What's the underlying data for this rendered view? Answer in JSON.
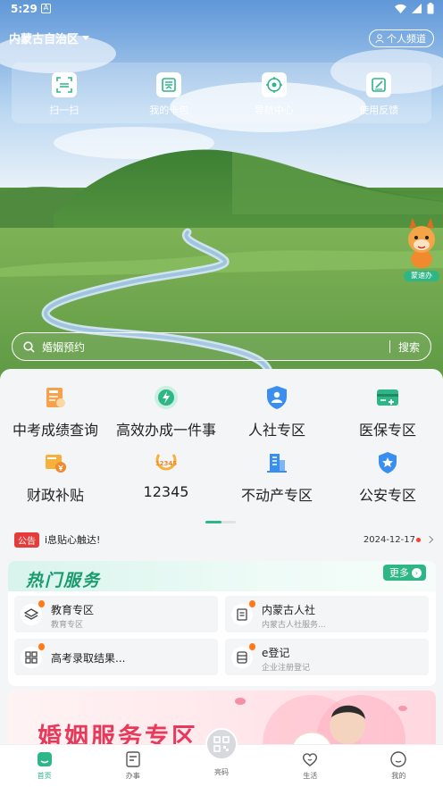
{
  "status_bar": {
    "time": "5:29",
    "indicator": "A"
  },
  "header": {
    "region": "内蒙古自治区",
    "personal": "个人频道"
  },
  "quick_actions": [
    {
      "label": "扫一扫",
      "icon": "scan-icon"
    },
    {
      "label": "我的卡包",
      "icon": "card-wallet-icon"
    },
    {
      "label": "导航中心",
      "icon": "navigation-icon"
    },
    {
      "label": "使用反馈",
      "icon": "feedback-icon"
    }
  ],
  "search": {
    "placeholder": "婚姻预约",
    "button": "搜索"
  },
  "services": [
    {
      "label": "中考成绩查询",
      "icon": "exam-score-icon",
      "color": "#f08a2c"
    },
    {
      "label": "高效办成一件事",
      "icon": "lightning-icon",
      "color": "#2eb687"
    },
    {
      "label": "人社专区",
      "icon": "shield-person-icon",
      "color": "#3a8ef0"
    },
    {
      "label": "医保专区",
      "icon": "medical-card-icon",
      "color": "#2eb687"
    },
    {
      "label": "财政补贴",
      "icon": "subsidy-icon",
      "color": "#f0a32c"
    },
    {
      "label": "12345",
      "icon": "hotline-icon",
      "color": "#f0a32c"
    },
    {
      "label": "不动产专区",
      "icon": "building-icon",
      "color": "#3a8ef0"
    },
    {
      "label": "公安专区",
      "icon": "police-badge-icon",
      "color": "#3a8ef0"
    }
  ],
  "pager": {
    "pages": 2,
    "current": 1
  },
  "notice": {
    "tag": "公告",
    "text": "i息贴心触达!",
    "date": "2024-12-17"
  },
  "hot_services": {
    "title": "热门服务",
    "more": "更多",
    "items": [
      {
        "title": "教育专区",
        "subtitle": "教育专区",
        "icon": "layers-icon"
      },
      {
        "title": "内蒙古人社",
        "subtitle": "内蒙古人社服务...",
        "icon": "document-icon"
      },
      {
        "title": "高考录取结果...",
        "subtitle": "",
        "icon": "grid-apps-icon"
      },
      {
        "title": "e登记",
        "subtitle": "企业注册登记",
        "icon": "database-icon"
      }
    ]
  },
  "mascot": {
    "badge": "蒙速办"
  },
  "banner": {
    "title": "婚姻服务专区"
  },
  "nav": {
    "items": [
      {
        "label": "首页",
        "icon": "home-icon",
        "active": true
      },
      {
        "label": "办事",
        "icon": "tasks-icon",
        "active": false
      },
      {
        "label": "亮码",
        "icon": "qr-code-icon",
        "active": false
      },
      {
        "label": "生活",
        "icon": "heart-icon",
        "active": false
      },
      {
        "label": "我的",
        "icon": "profile-icon",
        "active": false
      }
    ]
  },
  "colors": {
    "accent": "#2eb687",
    "notice_tag": "#e73b3b",
    "banner_title": "#e8395a"
  }
}
